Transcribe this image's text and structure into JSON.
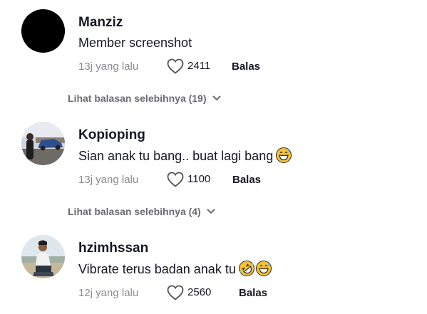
{
  "comments": [
    {
      "username": "Manziz",
      "text": "Member screenshot",
      "time": "13j yang lalu",
      "likes": "2411",
      "reply_label": "Balas",
      "emojis": [],
      "avatar_icon": "black-circle-avatar"
    },
    {
      "username": "Kopioping",
      "text": "Sian anak tu bang.. buat lagi bang",
      "time": "13j yang lalu",
      "likes": "1100",
      "reply_label": "Balas",
      "emojis": [
        "grinning-sweat-emoji"
      ],
      "avatar_icon": "car-photo-avatar"
    },
    {
      "username": "hzimhssan",
      "text": "Vibrate terus badan anak tu",
      "time": "12j yang lalu",
      "likes": "2560",
      "reply_label": "Balas",
      "emojis": [
        "rolling-laughing-emoji",
        "grinning-sweat-emoji"
      ],
      "avatar_icon": "person-photo-avatar"
    }
  ],
  "more_replies": [
    {
      "label": "Lihat balasan selebihnya (19)"
    },
    {
      "label": "Lihat balasan selebihnya (4)"
    }
  ],
  "colors": {
    "text": "#161823",
    "muted": "#8a8b91",
    "more": "#6b6c72",
    "emoji_yellow": "#f7c331"
  }
}
